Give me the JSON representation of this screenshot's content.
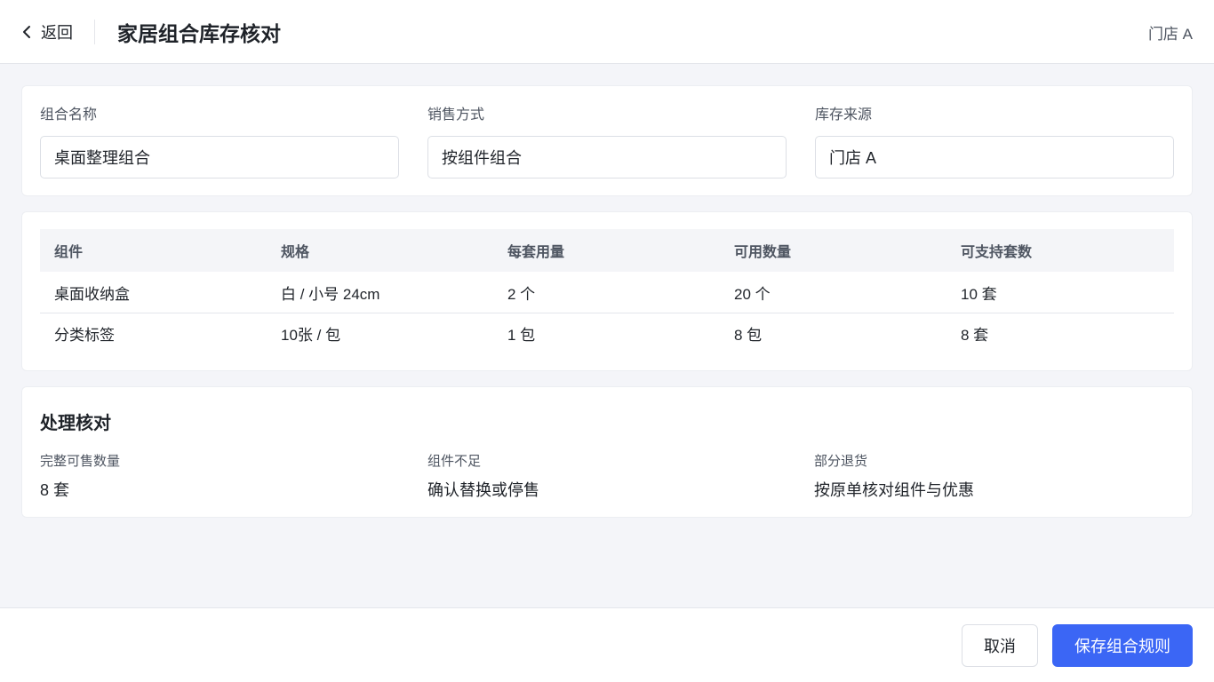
{
  "header": {
    "back_label": "返回",
    "title": "家居组合库存核对",
    "store": "门店 A"
  },
  "form": {
    "fields": [
      {
        "label": "组合名称",
        "value": "桌面整理组合"
      },
      {
        "label": "销售方式",
        "value": "按组件组合"
      },
      {
        "label": "库存来源",
        "value": "门店 A"
      }
    ]
  },
  "table": {
    "headers": [
      "组件",
      "规格",
      "每套用量",
      "可用数量",
      "可支持套数"
    ],
    "rows": [
      [
        "桌面收纳盒",
        "白 / 小号 24cm",
        "2 个",
        "20 个",
        "10 套"
      ],
      [
        "分类标签",
        "10张 / 包",
        "1 包",
        "8 包",
        "8 套"
      ]
    ]
  },
  "process": {
    "title": "处理核对",
    "items": [
      {
        "label": "完整可售数量",
        "value": "8 套"
      },
      {
        "label": "组件不足",
        "value": "确认替换或停售"
      },
      {
        "label": "部分退货",
        "value": "按原单核对组件与优惠"
      }
    ]
  },
  "footer": {
    "cancel_label": "取消",
    "save_label": "保存组合规则"
  },
  "colors": {
    "primary": "#3b66f5",
    "background": "#f4f5f9"
  }
}
